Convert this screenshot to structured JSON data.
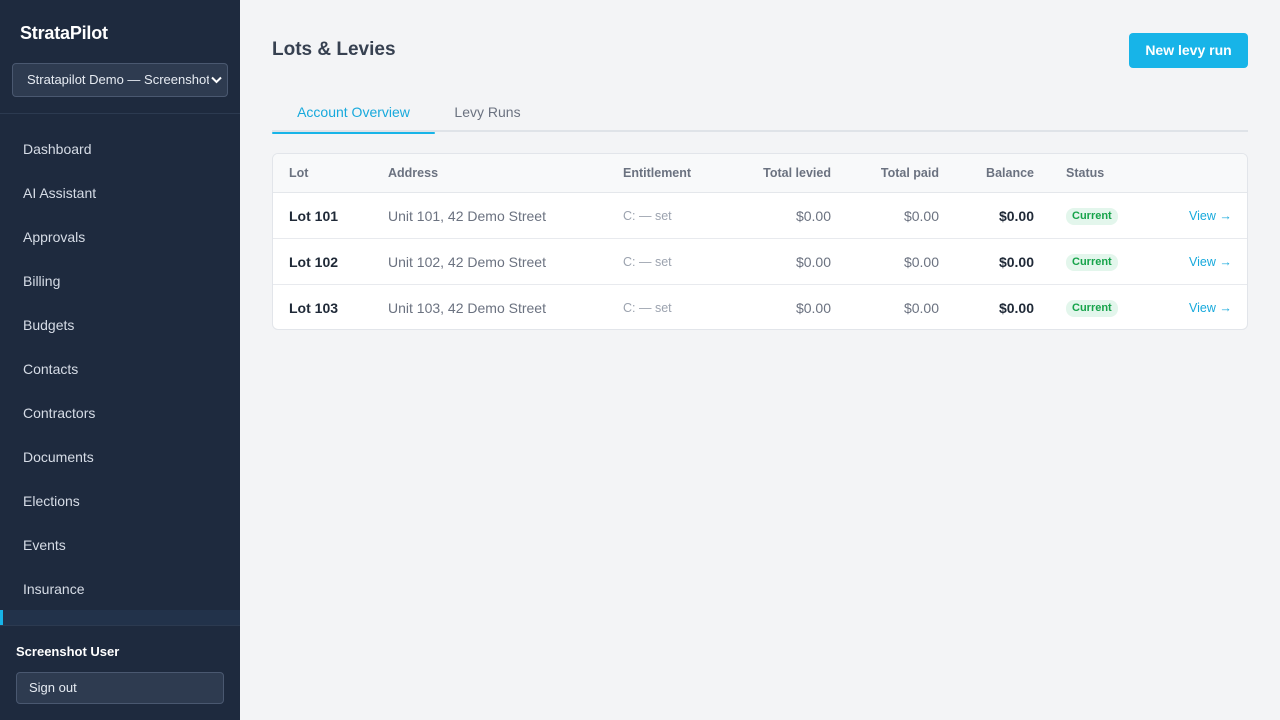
{
  "sidebar": {
    "brand": "StrataPilot",
    "org_select": "Stratapilot Demo — Screenshot",
    "items": [
      {
        "label": "Dashboard"
      },
      {
        "label": "AI Assistant"
      },
      {
        "label": "Approvals"
      },
      {
        "label": "Billing"
      },
      {
        "label": "Budgets"
      },
      {
        "label": "Contacts"
      },
      {
        "label": "Contractors"
      },
      {
        "label": "Documents"
      },
      {
        "label": "Elections"
      },
      {
        "label": "Events"
      },
      {
        "label": "Insurance"
      }
    ],
    "user_name": "Screenshot User",
    "sign_out": "Sign out"
  },
  "header": {
    "title": "Lots & Levies",
    "new_levy_run": "New levy run"
  },
  "tabs": [
    {
      "label": "Account Overview",
      "active": true
    },
    {
      "label": "Levy Runs",
      "active": false
    }
  ],
  "table": {
    "columns": [
      "Lot",
      "Address",
      "Entitlement",
      "Total levied",
      "Total paid",
      "Balance",
      "Status"
    ],
    "rows": [
      {
        "lot": "Lot 101",
        "address": "Unit 101, 42 Demo Street",
        "entitlement": "C: — set",
        "levied": "$0.00",
        "paid": "$0.00",
        "balance": "$0.00",
        "status": "Current",
        "action": "View →"
      },
      {
        "lot": "Lot 102",
        "address": "Unit 102, 42 Demo Street",
        "entitlement": "C: — set",
        "levied": "$0.00",
        "paid": "$0.00",
        "balance": "$0.00",
        "status": "Current",
        "action": "View →"
      },
      {
        "lot": "Lot 103",
        "address": "Unit 103, 42 Demo Street",
        "entitlement": "C: — set",
        "levied": "$0.00",
        "paid": "$0.00",
        "balance": "$0.00",
        "status": "Current",
        "action": "View →"
      }
    ]
  },
  "colors": {
    "accent": "#17b4e8",
    "sidebar_bg": "#1e2a3e",
    "status_current": "#16a34a"
  }
}
